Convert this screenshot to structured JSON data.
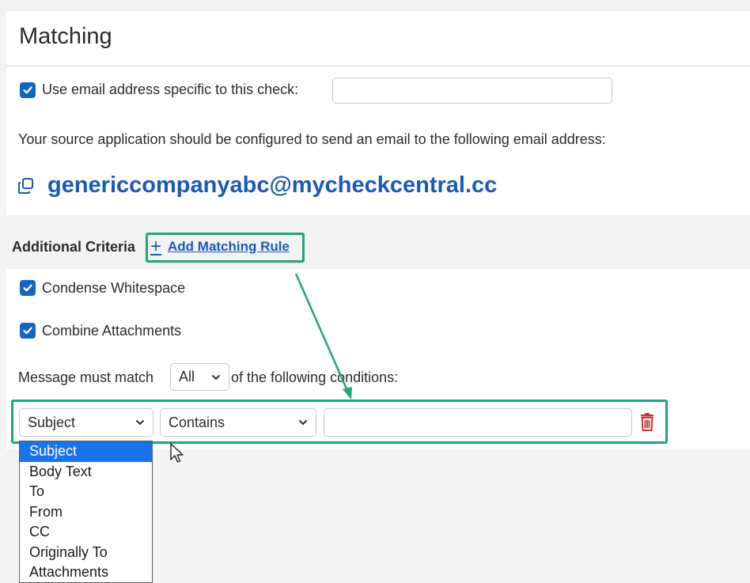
{
  "section": {
    "title": "Matching"
  },
  "email_specific": {
    "checked": true,
    "label": "Use email address specific to this check:",
    "value": "",
    "placeholder": ""
  },
  "info_text": "Your source application should be configured to send an email to the following email address:",
  "email_address": "genericcompanyabc@mycheckcentral.cc",
  "criteria": {
    "header": "Additional Criteria",
    "add_rule_icon": "+",
    "add_rule_label": "Add Matching Rule"
  },
  "options": {
    "condense_whitespace": {
      "checked": true,
      "label": "Condense Whitespace"
    },
    "combine_attachments": {
      "checked": true,
      "label": "Combine Attachments"
    }
  },
  "match": {
    "prefix": "Message must match",
    "selected": "All",
    "suffix": "of the following conditions:"
  },
  "rule": {
    "field": "Subject",
    "operator": "Contains",
    "value": ""
  },
  "field_options": [
    "Subject",
    "Body Text",
    "To",
    "From",
    "CC",
    "Originally To",
    "Attachments"
  ],
  "colors": {
    "accent": "#1565c0",
    "link": "#1a59b8",
    "highlight": "#1fa57c",
    "delete": "#d32f2f",
    "dropdown_selected": "#1a73e8"
  }
}
